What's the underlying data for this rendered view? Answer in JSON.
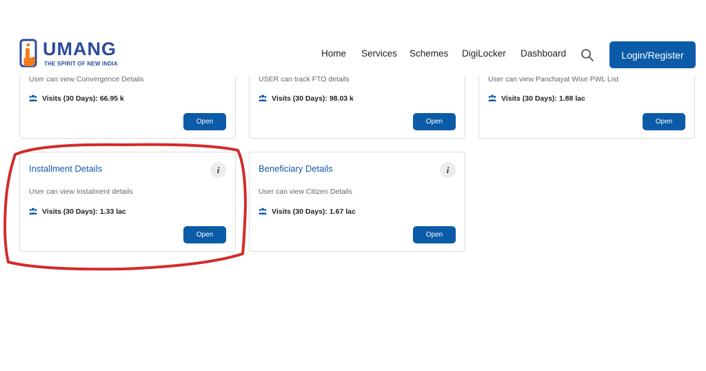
{
  "header": {
    "logo_text": "UMANG",
    "logo_tagline": "THE SPIRIT OF NEW INDIA",
    "nav": [
      {
        "label": "Home"
      },
      {
        "label": "Services"
      },
      {
        "label": "Schemes"
      },
      {
        "label": "DigiLocker"
      },
      {
        "label": "Dashboard"
      }
    ],
    "search_icon": "search-icon",
    "login_label": "Login/Register"
  },
  "colors": {
    "primary": "#0b5ba8",
    "brand": "#2a4a9c",
    "logo_orange": "#f07d1a",
    "highlight": "#d42a2a"
  },
  "cards_row1": [
    {
      "description": "User can view Convergence Details",
      "visits": "Visits (30 Days): 66.95 k",
      "open_label": "Open"
    },
    {
      "description": "USER can track FTO details",
      "visits": "Visits (30 Days): 98.03 k",
      "open_label": "Open"
    },
    {
      "description": "User can view Panchayat Wise PWL List",
      "visits": "Visits (30 Days): 1.88 lac",
      "open_label": "Open"
    }
  ],
  "cards_row2": [
    {
      "title": "Installment Details",
      "info": "i",
      "description": "User can view Instalment details",
      "visits": "Visits (30 Days): 1.33 lac",
      "open_label": "Open"
    },
    {
      "title": "Beneficiary Details",
      "info": "i",
      "description": "User can view Citizen Details",
      "visits": "Visits (30 Days): 1.67 lac",
      "open_label": "Open"
    }
  ]
}
